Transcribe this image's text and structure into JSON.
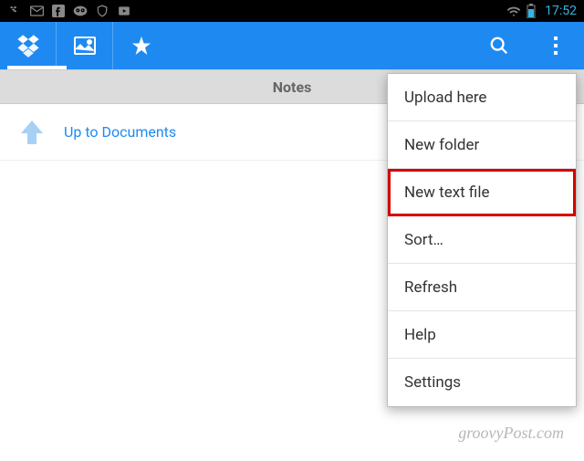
{
  "status_bar": {
    "time": "17:52"
  },
  "section_header": "Notes",
  "up_row": {
    "label": "Up to Documents"
  },
  "menu": {
    "items": [
      {
        "label": "Upload here",
        "highlighted": false
      },
      {
        "label": "New folder",
        "highlighted": false
      },
      {
        "label": "New text file",
        "highlighted": true
      },
      {
        "label": "Sort…",
        "highlighted": false
      },
      {
        "label": "Refresh",
        "highlighted": false
      },
      {
        "label": "Help",
        "highlighted": false
      },
      {
        "label": "Settings",
        "highlighted": false
      }
    ]
  },
  "watermark": "groovyPost.com"
}
